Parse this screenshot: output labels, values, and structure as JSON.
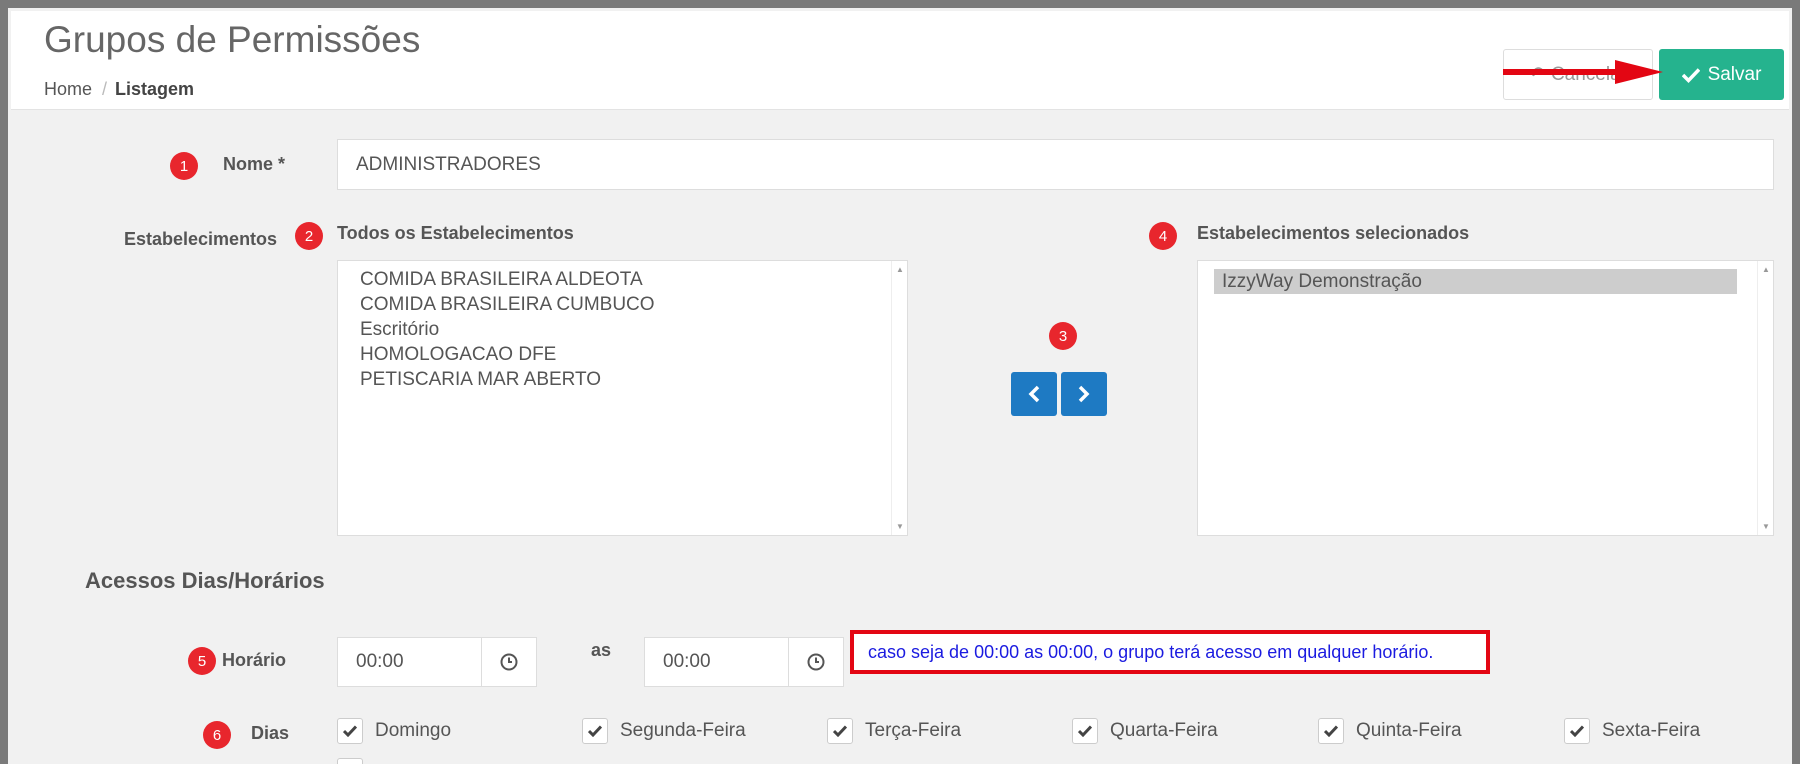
{
  "header": {
    "title": "Grupos de Permissões",
    "breadcrumb_home": "Home",
    "breadcrumb_sep": "/",
    "breadcrumb_current": "Listagem",
    "cancel_label": "Cancelar",
    "save_label": "Salvar"
  },
  "form": {
    "name_label": "Nome *",
    "name_value": "ADMINISTRADORES",
    "establishments_label": "Estabelecimentos",
    "all_title": "Todos os Estabelecimentos",
    "all_items": [
      "COMIDA BRASILEIRA ALDEOTA",
      "COMIDA BRASILEIRA CUMBUCO",
      "Escritório",
      "HOMOLOGACAO DFE",
      "PETISCARIA MAR ABERTO"
    ],
    "selected_title": "Estabelecimentos selecionados",
    "selected_items": [
      "IzzyWay Demonstração"
    ],
    "access_section": "Acessos Dias/Horários",
    "time_label": "Horário",
    "time_from": "00:00",
    "time_separator": "as",
    "time_to": "00:00",
    "time_note": "caso seja de 00:00 as 00:00, o grupo terá acesso em qualquer horário.",
    "days_label": "Dias",
    "days": [
      "Domingo",
      "Segunda-Feira",
      "Terça-Feira",
      "Quarta-Feira",
      "Quinta-Feira",
      "Sexta-Feira"
    ]
  },
  "badges": [
    "1",
    "2",
    "3",
    "4",
    "5",
    "6"
  ],
  "colors": {
    "save": "#25b38e",
    "move_buttons": "#1e7ac3",
    "badge": "#e8262d",
    "note_border": "#e30613",
    "note_text": "#1b1be0"
  }
}
